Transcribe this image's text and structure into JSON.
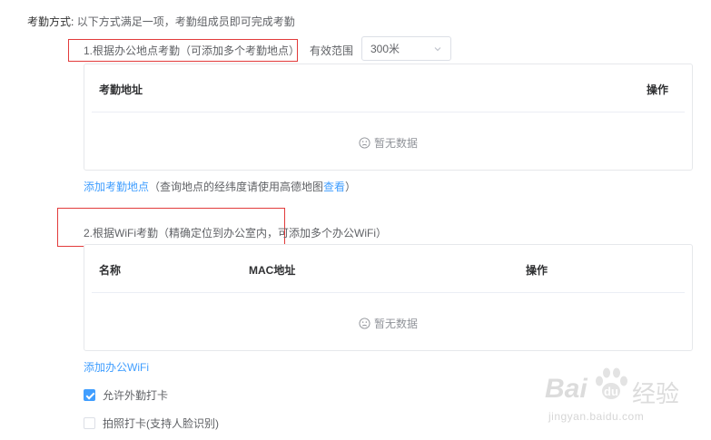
{
  "attendance_mode": {
    "label": "考勤方式:",
    "description": "以下方式满足一项，考勤组成员即可完成考勤"
  },
  "location_option": {
    "title": "1.根据办公地点考勤（可添加多个考勤地点）",
    "range_label": "有效范围",
    "range_value": "300米",
    "table": {
      "columns": [
        "考勤地址",
        "操作"
      ],
      "empty_text": "暂无数据"
    },
    "add_link": "添加考勤地点",
    "hint_before": "（查询地点的经纬度请使用高德地图",
    "hint_link": "查看",
    "hint_after": "）"
  },
  "wifi_option": {
    "title": "2.根据WiFi考勤（精确定位到办公室内，可添加多个办公WiFi）",
    "table": {
      "columns": [
        "名称",
        "MAC地址",
        "操作"
      ],
      "empty_text": "暂无数据"
    },
    "add_link": "添加办公WiFi"
  },
  "checkboxes": [
    {
      "label": "允许外勤打卡",
      "checked": true
    },
    {
      "label": "拍照打卡(支持人脸识别)",
      "checked": false
    }
  ],
  "watermark": {
    "brand": "Bai",
    "brand_suffix": "经验",
    "url": "jingyan.baidu.com"
  },
  "colors": {
    "accent": "#409eff",
    "annotation_red": "#e23b3b",
    "border": "#e6e8eb"
  }
}
